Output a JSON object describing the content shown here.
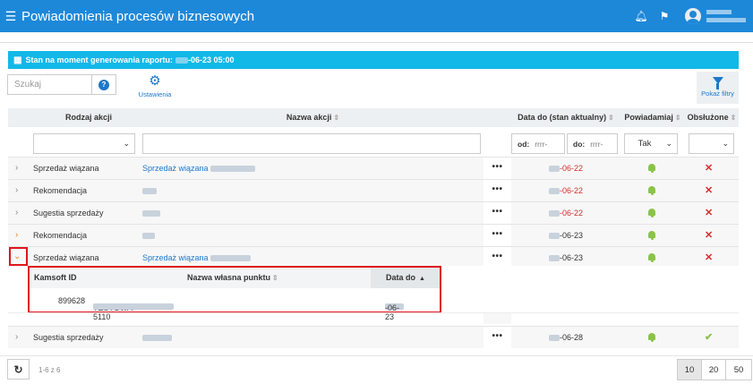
{
  "app": {
    "title": "Powiadomienia procesów biznesowych"
  },
  "banner": {
    "label": "Stan na moment generowania raportu:",
    "date_suffix": "-06-23 05:00"
  },
  "toolbar": {
    "search_placeholder": "Szukaj",
    "help_glyph": "?",
    "settings_label": "Ustawienia",
    "filters_label": "Pokaż filtry"
  },
  "columns": {
    "type": "Rodzaj akcji",
    "name": "Nazwa akcji",
    "date": "Data do (stan aktualny)",
    "notify": "Powiadamiaj",
    "handled": "Obsłużone"
  },
  "filters": {
    "from_label": "od:",
    "to_label": "do:",
    "date_placeholder": "rrrr-",
    "notify_value": "Tak"
  },
  "rows": [
    {
      "type": "Sprzedaż wiązana",
      "name": "Sprzedaż wiązana",
      "date": "-06-22",
      "overdue": true,
      "handled": false
    },
    {
      "type": "Rekomendacja",
      "name": "",
      "date": "-06-22",
      "overdue": true,
      "handled": false
    },
    {
      "type": "Sugestia sprzedaży",
      "name": "",
      "date": "-06-22",
      "overdue": true,
      "handled": false
    },
    {
      "type": "Rekomendacja",
      "name": "",
      "date": "-06-23",
      "overdue": false,
      "handled": false
    },
    {
      "type": "Sprzedaż wiązana",
      "name": "Sprzedaż wiązana",
      "date": "-06-23",
      "overdue": false,
      "handled": false,
      "expanded": true
    },
    {
      "type": "Sugestia sprzedaży",
      "name": "",
      "date": "-06-28",
      "overdue": false,
      "handled": true
    }
  ],
  "row_actions_label": "•••",
  "subtable": {
    "columns": {
      "id": "Kamsoft ID",
      "name": "Nazwa własna punktu",
      "date": "Data do"
    },
    "row": {
      "id": "899628",
      "name": "TESTOWA 5110",
      "date": "-06-23"
    }
  },
  "footer": {
    "count": "1-6 z 6",
    "page_sizes": [
      "10",
      "20",
      "50"
    ],
    "active_page_size": "10"
  },
  "icons": {
    "menu": "menu-icon",
    "bell": "bell-icon",
    "flag": "flag-icon",
    "avatar": "user-avatar-icon",
    "calendar": "calendar-icon",
    "gear": "gear-icon",
    "filter": "filter-icon",
    "refresh": "refresh-icon",
    "expand": "chevron-right-icon",
    "collapse": "chevron-down-icon",
    "check": "check-icon",
    "cross": "cross-icon"
  },
  "colors": {
    "primary": "#1e88d8",
    "banner": "#12b8e8",
    "overdue": "#d32f2f",
    "notify": "#8bc34a",
    "highlight": "#e0151d"
  }
}
